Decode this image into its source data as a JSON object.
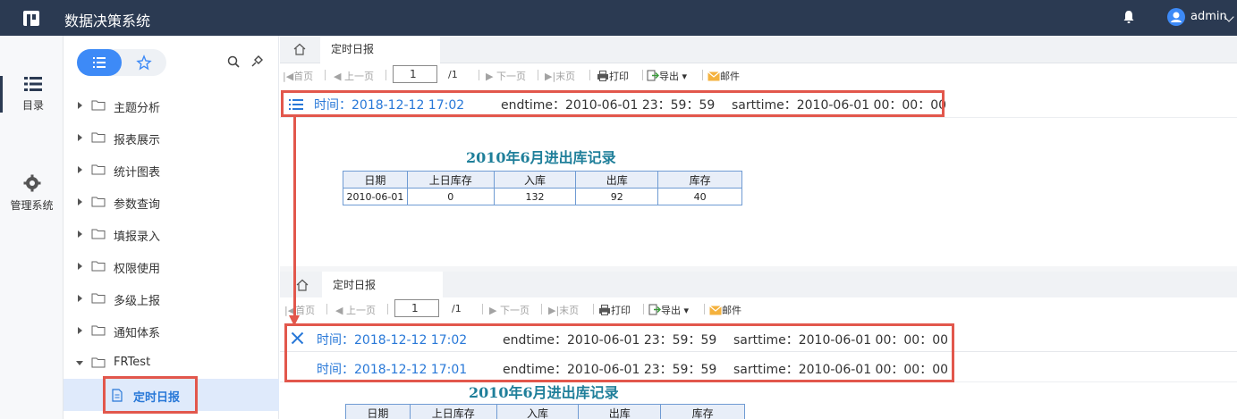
{
  "header": {
    "app_title": "数据决策系统",
    "user": "admin"
  },
  "rail": [
    {
      "label": "目录",
      "icon": "list-icon"
    },
    {
      "label": "管理系统",
      "icon": "gear-icon"
    }
  ],
  "tree": [
    {
      "label": "主题分析"
    },
    {
      "label": "报表展示"
    },
    {
      "label": "统计图表"
    },
    {
      "label": "参数查询"
    },
    {
      "label": "填报录入"
    },
    {
      "label": "权限使用"
    },
    {
      "label": "多级上报"
    },
    {
      "label": "通知体系"
    },
    {
      "label": "FRTest"
    }
  ],
  "tree_child": "定时日报",
  "tab_label": "定时日报",
  "toolbar": {
    "first": "首页",
    "prev": "上一页",
    "page": "1",
    "total": "/1",
    "next": "下一页",
    "last": "末页",
    "print": "打印",
    "export": "导出",
    "mail": "邮件"
  },
  "params_top": {
    "time": "时间：2018-12-12 17:02",
    "endtime": "endtime：2010-06-01 23：59：59",
    "sarttime": "sarttime：2010-06-01 00：00：00"
  },
  "params_list": [
    {
      "time": "时间：2018-12-12 17:02",
      "endtime": "endtime：2010-06-01 23：59：59",
      "sarttime": "sarttime：2010-06-01 00：00：00"
    },
    {
      "time": "时间：2018-12-12 17:01",
      "endtime": "endtime：2010-06-01 23：59：59",
      "sarttime": "sarttime：2010-06-01 00：00：00"
    }
  ],
  "report": {
    "title": "2010年6月进出库记录",
    "columns": [
      "日期",
      "上日库存",
      "入库",
      "出库",
      "库存"
    ],
    "rows": [
      [
        "2010-06-01",
        "0",
        "132",
        "92",
        "40"
      ]
    ]
  }
}
